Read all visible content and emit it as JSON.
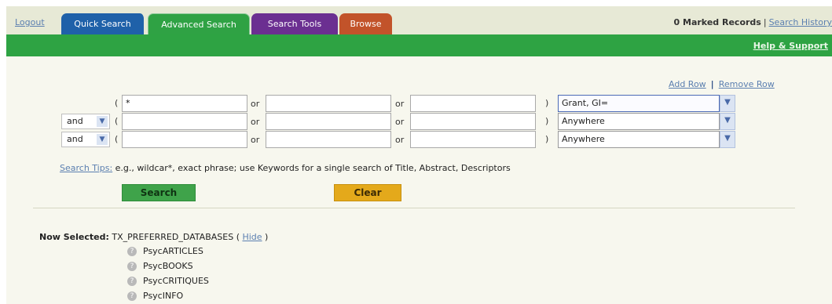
{
  "header": {
    "logout": "Logout",
    "tabs": [
      {
        "label": "Quick Search"
      },
      {
        "label": "Advanced Search"
      },
      {
        "label": "Search Tools"
      },
      {
        "label": "Browse"
      }
    ],
    "marked_records": "0 Marked Records",
    "separator": "|",
    "search_history": "Search History",
    "help_support": "Help & Support"
  },
  "row_controls": {
    "add_row": "Add Row",
    "separator": "|",
    "remove_row": "Remove Row"
  },
  "search": {
    "connector_label": "or",
    "rows": [
      {
        "operator": "",
        "term1": "*",
        "term2": "",
        "term3": "",
        "field": "Grant, GI="
      },
      {
        "operator": "and",
        "term1": "",
        "term2": "",
        "term3": "",
        "field": "Anywhere"
      },
      {
        "operator": "and",
        "term1": "",
        "term2": "",
        "term3": "",
        "field": "Anywhere"
      }
    ],
    "tips_link": "Search Tips:",
    "tips_text": " e.g., wildcar*, exact phrase; use Keywords for a single search of Title, Abstract, Descriptors",
    "search_button": "Search",
    "clear_button": "Clear"
  },
  "selection": {
    "label": "Now Selected:",
    "value": "TX_PREFERRED_DATABASES",
    "hide": "Hide",
    "databases": [
      "PsycARTICLES",
      "PsycBOOKS",
      "PsycCRITIQUES",
      "PsycINFO"
    ]
  }
}
